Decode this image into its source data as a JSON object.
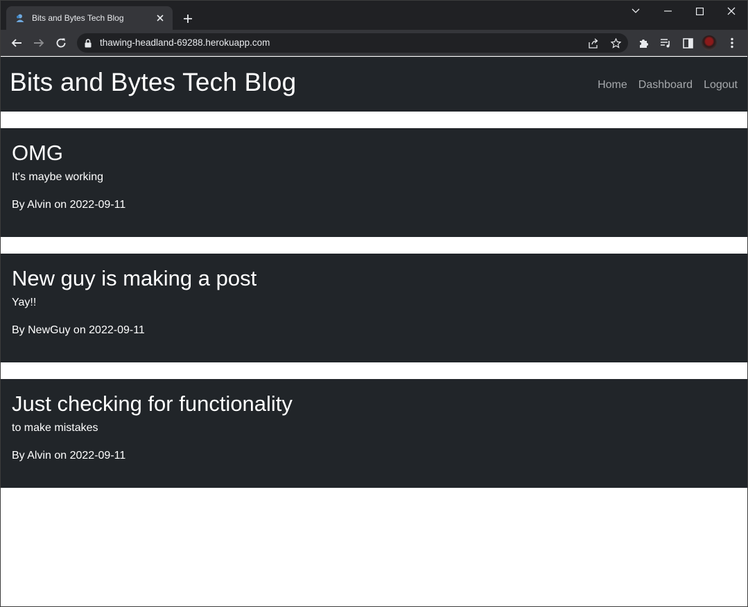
{
  "browser": {
    "tab_title": "Bits and Bytes Tech Blog",
    "url": "thawing-headland-69288.herokuapp.com"
  },
  "site": {
    "title": "Bits and Bytes Tech Blog",
    "nav": [
      "Home",
      "Dashboard",
      "Logout"
    ]
  },
  "posts": [
    {
      "title": "OMG",
      "body": "It's maybe working",
      "meta": "By Alvin on 2022-09-11"
    },
    {
      "title": "New guy is making a post",
      "body": "Yay!!",
      "meta": "By NewGuy on 2022-09-11"
    },
    {
      "title": "Just checking for functionality",
      "body": "to make mistakes",
      "meta": "By Alvin on 2022-09-11"
    }
  ],
  "colors": {
    "chrome_dark": "#202124",
    "chrome_toolbar": "#35363a",
    "site_bg": "#212529",
    "nav_link": "#a6a9ac"
  }
}
